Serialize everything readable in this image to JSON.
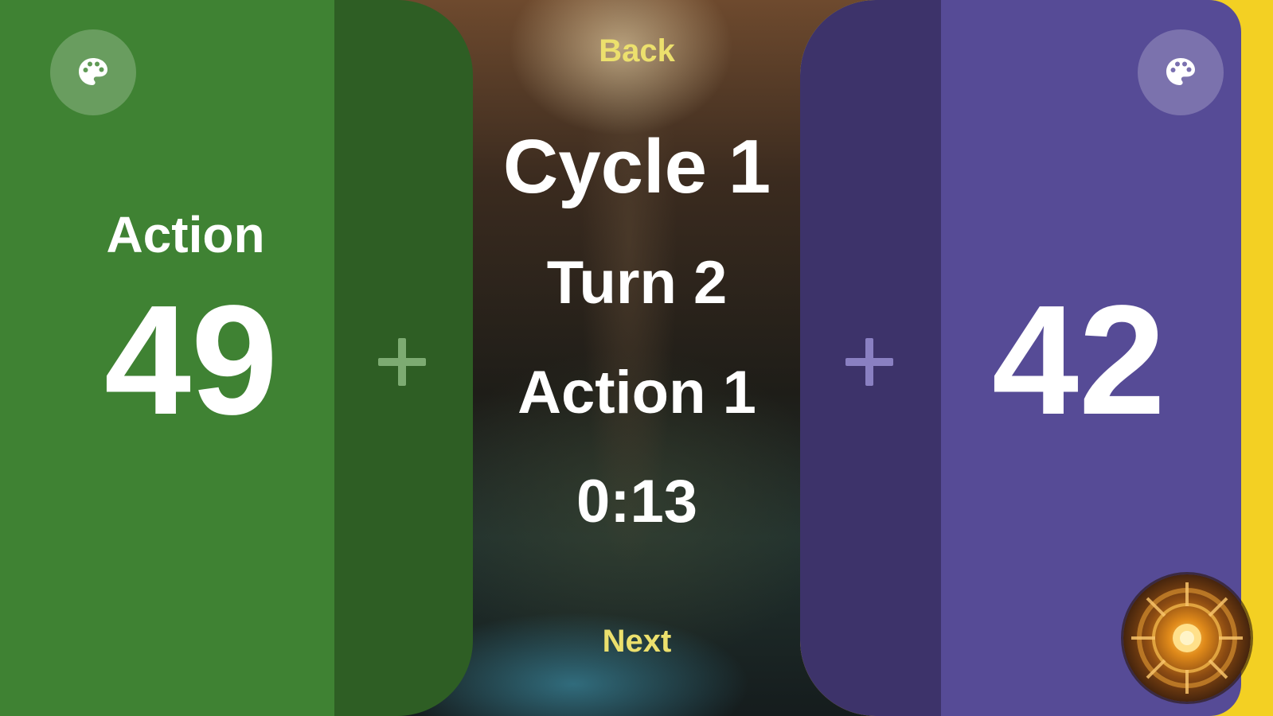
{
  "left_player": {
    "label": "Action",
    "score": "49",
    "color": "#3f8233",
    "increment_color": "#2e5e24",
    "palette_icon": "palette-icon",
    "plus_icon": "plus-icon"
  },
  "right_player": {
    "score": "42",
    "color": "#564b96",
    "increment_color": "#3d336a",
    "accent_color": "#f3d023",
    "palette_icon": "palette-icon",
    "plus_icon": "plus-icon",
    "avatar": "golden-emblem-avatar"
  },
  "center": {
    "back_label": "Back",
    "cycle_label": "Cycle 1",
    "turn_label": "Turn 2",
    "action_label": "Action 1",
    "timer": "0:13",
    "next_label": "Next",
    "nav_color": "#ece06d"
  }
}
